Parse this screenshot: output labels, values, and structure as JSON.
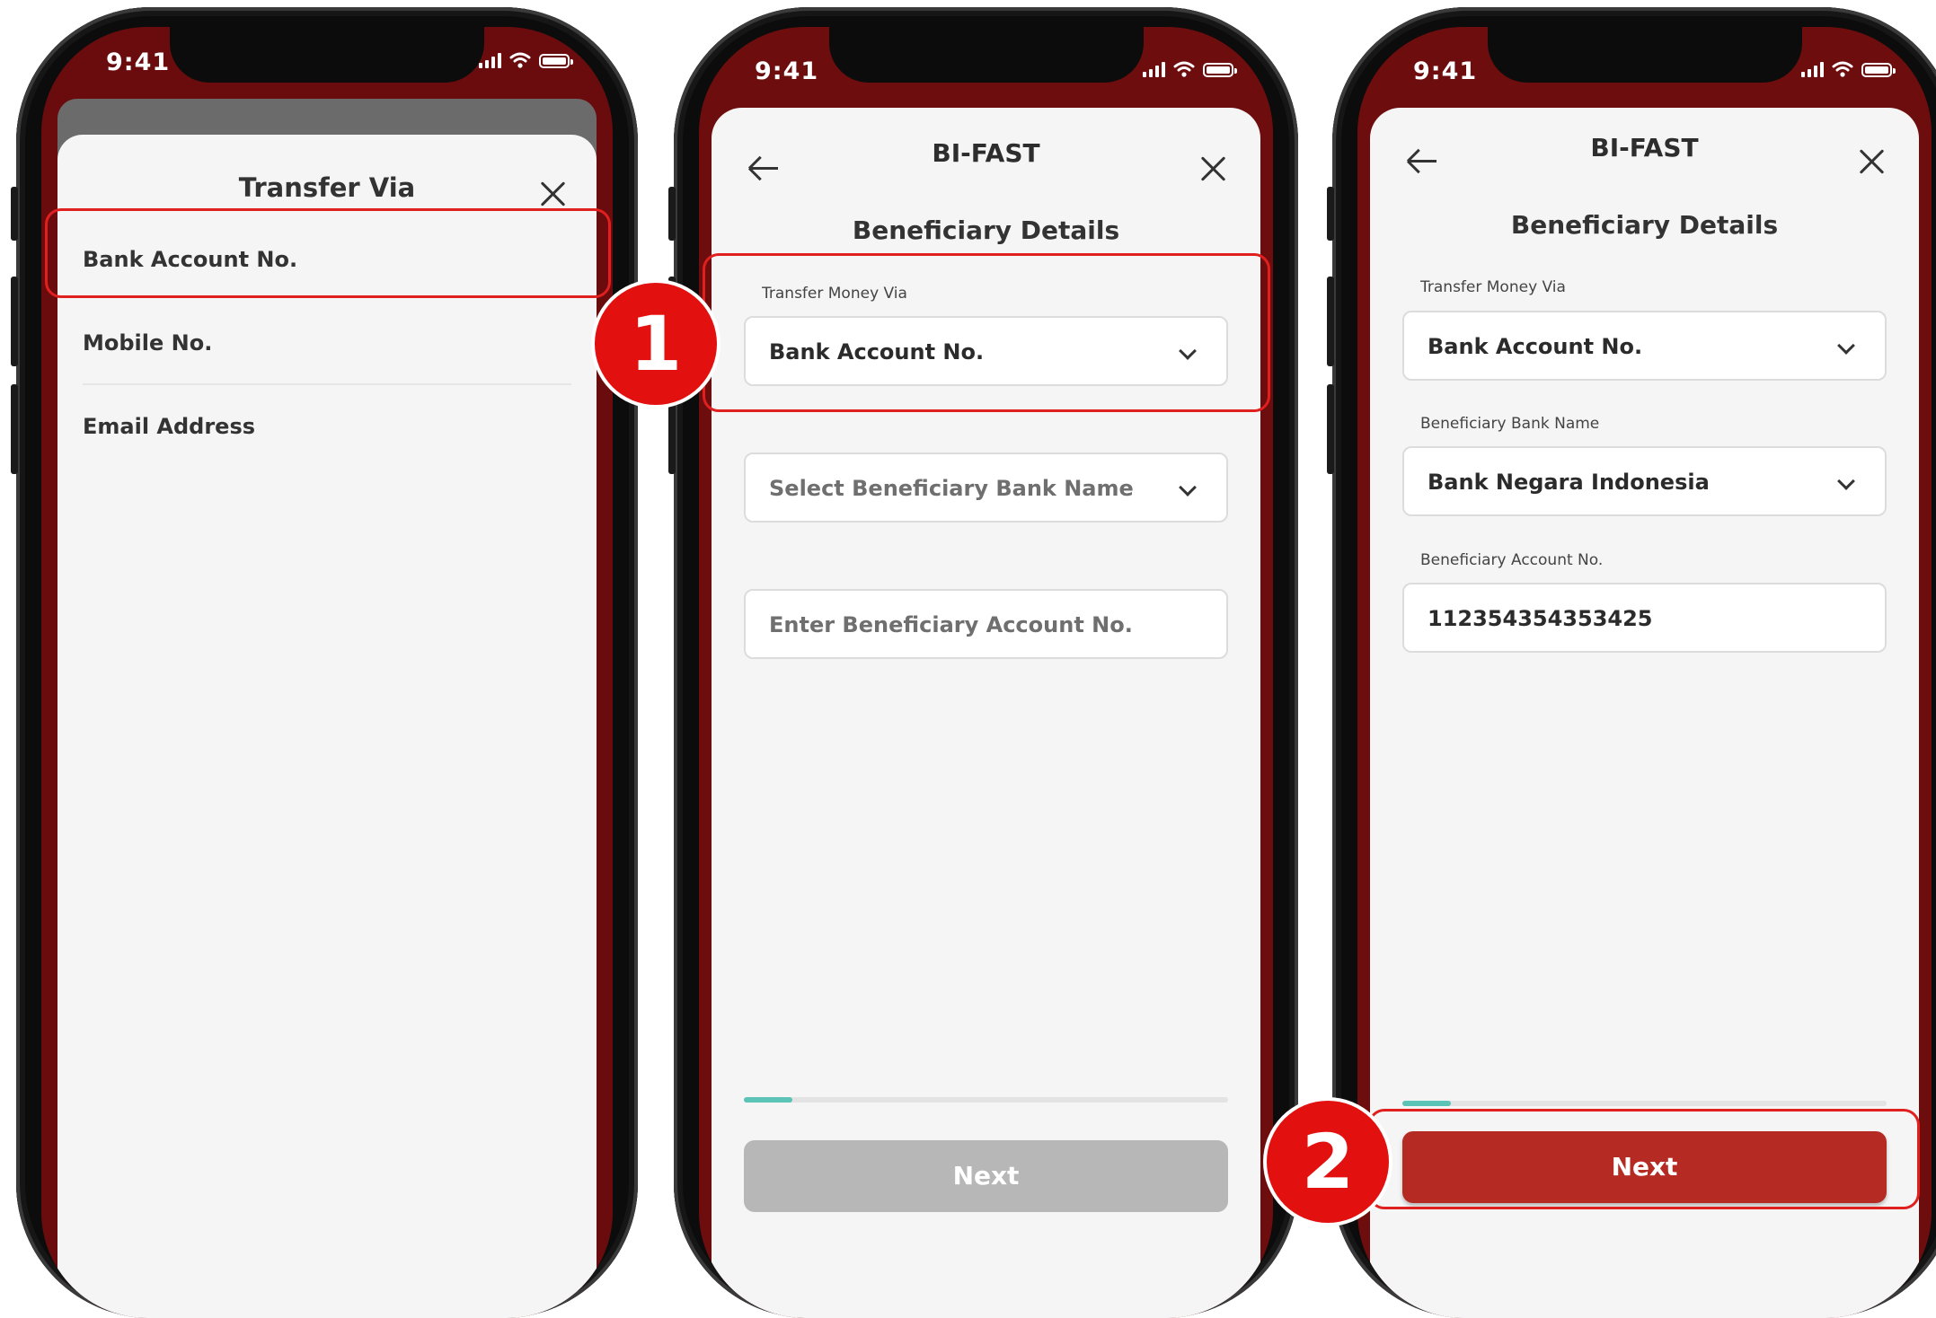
{
  "status_bar": {
    "time": "9:41"
  },
  "colors": {
    "brand_dark_red": "#6e0d0e",
    "next_active": "#b52a22",
    "progress_fill": "#5cc3b7",
    "highlight": "#e01f1f"
  },
  "screen1": {
    "title": "Transfer Via",
    "options": [
      "Bank Account No.",
      "Mobile No.",
      "Email Address"
    ],
    "selected_option": "Bank Account No."
  },
  "screen2": {
    "header_title": "BI-FAST",
    "section_title": "Beneficiary Details",
    "transfer_via_label": "Transfer Money Via",
    "transfer_via_value": "Bank Account No.",
    "bank_name_placeholder": "Select Beneficiary Bank Name",
    "account_no_placeholder": "Enter Beneficiary Account No.",
    "progress": 0.1,
    "next_label": "Next"
  },
  "screen3": {
    "header_title": "BI-FAST",
    "section_title": "Beneficiary Details",
    "transfer_via_label": "Transfer Money Via",
    "transfer_via_value": "Bank Account No.",
    "bank_name_label": "Beneficiary Bank Name",
    "bank_name_value": "Bank Negara Indonesia",
    "account_no_label": "Beneficiary Account No.",
    "account_no_value": "112354354353425",
    "progress": 0.1,
    "next_label": "Next"
  },
  "steps": [
    "1",
    "2"
  ],
  "icons": [
    "close-icon",
    "back-arrow-icon",
    "chevron-down-icon",
    "signal-icon",
    "wifi-icon",
    "battery-icon"
  ]
}
